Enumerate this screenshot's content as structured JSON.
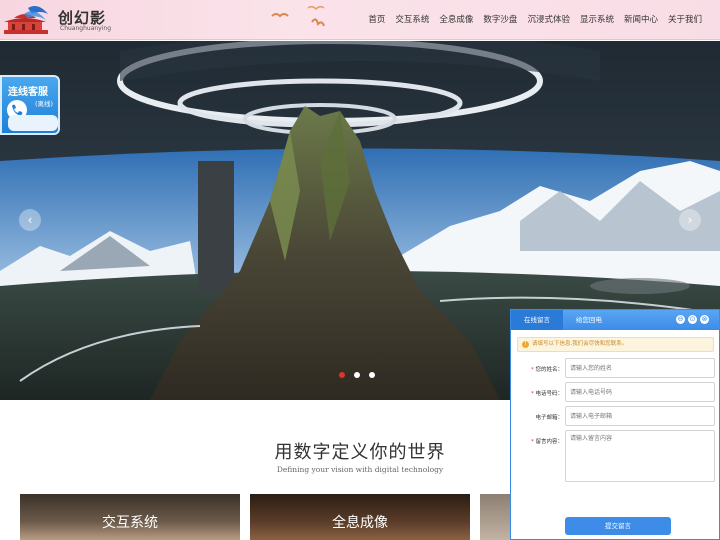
{
  "header": {
    "logo_cn": "创幻影",
    "logo_en": "Chuanghuanying",
    "nav": [
      "首页",
      "交互系统",
      "全息成像",
      "数字沙盘",
      "沉浸式体验",
      "显示系统",
      "新闻中心",
      "关于我们"
    ]
  },
  "hero": {
    "prev_icon": "‹",
    "next_icon": "›",
    "slide_count": 3,
    "active_slide": 1
  },
  "service_badge": {
    "title": "连线客服",
    "subtitle": "(离线)"
  },
  "section": {
    "title": "用数字定义你的世界",
    "subtitle": "Defining your vision with digital technology"
  },
  "cards": [
    {
      "label": "交互系统"
    },
    {
      "label": "全息成像"
    },
    {
      "label": ""
    }
  ],
  "message_panel": {
    "tabs": [
      "在线留言",
      "给您回电"
    ],
    "controls": [
      "⊖",
      "⊙",
      "⊗"
    ],
    "notice": "请填写以下信息,我们会尽快和您联系。",
    "fields": {
      "name": {
        "label": "您的姓名：",
        "placeholder": "请输入您的姓名"
      },
      "phone": {
        "label": "电话号码：",
        "placeholder": "请输入电话号码"
      },
      "email": {
        "label": "电子邮箱：",
        "placeholder": "请输入电子邮箱"
      },
      "message": {
        "label": "留言内容：",
        "placeholder": "请输入留言内容"
      }
    },
    "submit_label": "提交留言"
  },
  "colors": {
    "header_bg": "#f9dde6",
    "accent_blue": "#3c8ce8",
    "active_dot": "#e0342a",
    "notice_text": "#c58a2a"
  }
}
